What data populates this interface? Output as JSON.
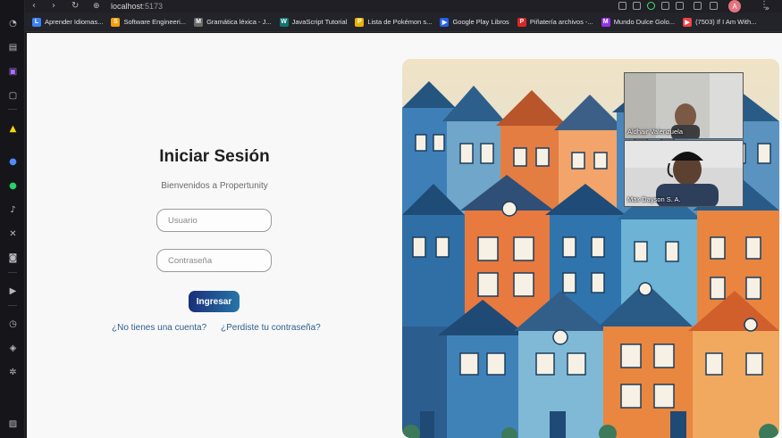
{
  "browser": {
    "url_host": "localhost",
    "url_port": ":5173",
    "profile_initial": "A",
    "bookmarks": [
      {
        "label": "Aprender Idiomas...",
        "color": "#3b82f6",
        "glyph": "L"
      },
      {
        "label": "Software Engineeri...",
        "color": "#f59e0b",
        "glyph": "S"
      },
      {
        "label": "Gramática léxica - J...",
        "color": "#6b6b6b",
        "glyph": "M"
      },
      {
        "label": "JavaScript Tutorial",
        "color": "#0f766e",
        "glyph": "W"
      },
      {
        "label": "Lista de Pokémon s...",
        "color": "#eab308",
        "glyph": "P"
      },
      {
        "label": "Google Play Libros",
        "color": "#2563eb",
        "glyph": "▶"
      },
      {
        "label": "Piñatería archivos -...",
        "color": "#dc2626",
        "glyph": "P"
      },
      {
        "label": "Mundo Dulce Golo...",
        "color": "#9333ea",
        "glyph": "M"
      },
      {
        "label": "(7503) If I Am With...",
        "color": "#ef4444",
        "glyph": "▶"
      }
    ],
    "more_label": "»"
  },
  "login": {
    "title": "Iniciar Sesión",
    "subtitle": "Bienvenidos a Propertunity",
    "username_placeholder": "Usuario",
    "password_placeholder": "Contraseña",
    "submit_label": "Ingresar",
    "no_account_link": "¿No tienes una cuenta?",
    "forgot_password_link": "¿Perdiste tu contraseña?"
  },
  "video_call": {
    "participants": [
      {
        "name": "Aldhair Valenzuela"
      },
      {
        "name": "Max Dayson S. A."
      }
    ]
  },
  "dock_icons": [
    "speedometer-icon",
    "briefcase-icon",
    "twitch-icon",
    "box-icon",
    "arrow-icon",
    "messenger-icon",
    "whatsapp-icon",
    "tiktok-icon",
    "x-icon",
    "discord-icon",
    "play-icon",
    "clock-icon",
    "cube-icon",
    "settings-icon",
    "image-icon"
  ]
}
